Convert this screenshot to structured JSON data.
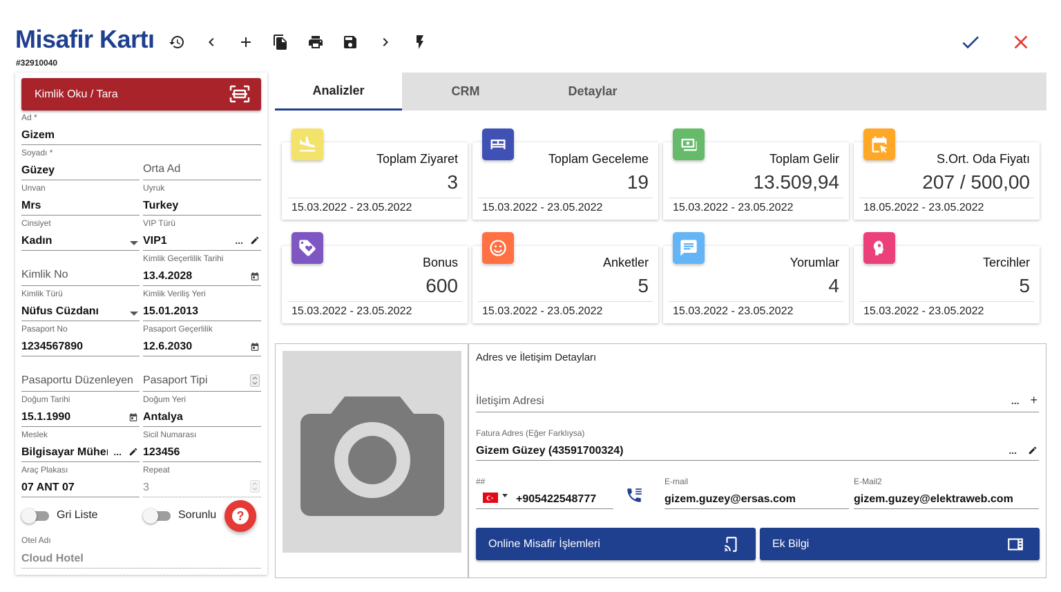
{
  "header": {
    "title": "Misafir Kartı",
    "record_id": "#32910040",
    "toolbar_icons": [
      "history-icon",
      "chevron-left-icon",
      "plus-icon",
      "copy-icon",
      "print-icon",
      "save-icon",
      "chevron-right-icon",
      "flash-icon"
    ],
    "confirm_icon": "check-icon",
    "close_icon": "close-icon",
    "accent": "#1f3f8f",
    "danger": "#e53935"
  },
  "left": {
    "scan_button": "Kimlik Oku / Tara",
    "ad": {
      "label": "Ad *",
      "value": "Gizem"
    },
    "soyadi": {
      "label": "Soyadı *",
      "value": "Güzey"
    },
    "orta_ad": {
      "placeholder": "Orta Ad"
    },
    "unvan": {
      "label": "Unvan",
      "value": "Mrs"
    },
    "uyruk": {
      "label": "Uyruk",
      "value": "Turkey"
    },
    "cinsiyet": {
      "label": "Cinsiyet",
      "value": "Kadın"
    },
    "vip_turu": {
      "label": "VIP Türü",
      "value": "VIP1"
    },
    "kimlik_no": {
      "placeholder": "Kimlik No"
    },
    "kimlik_gecerlilik": {
      "label": "Kimlik Geçerlilik Tarihi",
      "value": "13.4.2028"
    },
    "kimlik_turu": {
      "label": "Kimlik Türü",
      "value": "Nüfus Cüzdanı"
    },
    "kimlik_verilis": {
      "label": "Kimlik Veriliş Yeri",
      "value": "15.01.2013"
    },
    "pasaport_no": {
      "label": "Pasaport No",
      "value": "1234567890"
    },
    "pasaport_gecerlilik": {
      "label": "Pasaport Geçerlilik",
      "value": "12.6.2030"
    },
    "pasaport_duzenleyen": {
      "placeholder": "Pasaportu Düzenleyen"
    },
    "pasaport_tipi": {
      "placeholder": "Pasaport Tipi"
    },
    "dogum_tarihi": {
      "label": "Doğum Tarihi",
      "value": "15.1.1990"
    },
    "dogum_yeri": {
      "label": "Doğum Yeri",
      "value": "Antalya"
    },
    "meslek": {
      "label": "Meslek",
      "value": "Bilgisayar Müher"
    },
    "sicil": {
      "label": "Sicil Numarası",
      "value": "123456"
    },
    "arac_plakasi": {
      "label": "Araç Plakası",
      "value": "07 ANT 07"
    },
    "repeat": {
      "label": "Repeat",
      "value": "3"
    },
    "gri_liste": "Gri Liste",
    "sorunlu": "Sorunlu",
    "otel_adi": {
      "label": "Otel Adı",
      "value": "Cloud Hotel"
    },
    "ellipsis": "...",
    "help_glyph": "?"
  },
  "tabs": [
    "Analizler",
    "CRM",
    "Detaylar"
  ],
  "cards": [
    {
      "title": "Toplam Ziyaret",
      "value": "3",
      "date": "15.03.2022 - 23.05.2022",
      "icon": "flight-land-icon",
      "color": "#f4e36b"
    },
    {
      "title": "Toplam Geceleme",
      "value": "19",
      "date": "15.03.2022 - 23.05.2022",
      "icon": "bed-icon",
      "color": "#3f51b5"
    },
    {
      "title": "Toplam Gelir",
      "value": "13.509,94",
      "date": "15.03.2022 - 23.05.2022",
      "icon": "money-icon",
      "color": "#66bb6a"
    },
    {
      "title": "S.Ort. Oda Fiyatı",
      "value": "207 / 500,00",
      "date": "18.05.2022 - 23.05.2022",
      "icon": "calendar-icon",
      "color": "#ffa726"
    },
    {
      "title": "Bonus",
      "value": "600",
      "date": "15.03.2022 - 23.05.2022",
      "icon": "tag-icon",
      "color": "#7e57c2"
    },
    {
      "title": "Anketler",
      "value": "5",
      "date": "15.03.2022 - 23.05.2022",
      "icon": "smile-icon",
      "color": "#ff7043"
    },
    {
      "title": "Yorumlar",
      "value": "4",
      "date": "15.03.2022 - 23.05.2022",
      "icon": "comment-icon",
      "color": "#64b5f6"
    },
    {
      "title": "Tercihler",
      "value": "5",
      "date": "15.03.2022 - 23.05.2022",
      "icon": "preference-icon",
      "color": "#ec407a"
    }
  ],
  "address": {
    "title": "Adres ve İletişim Detayları",
    "iletisim_adresi": {
      "placeholder": "İletişim Adresi"
    },
    "fatura": {
      "label": "Fatura Adres (Eğer Farklıysa)",
      "value": "Gizem Güzey (43591700324)"
    },
    "phone": {
      "label": "##",
      "value": "+905422548777"
    },
    "email": {
      "label": "E-mail",
      "value": "gizem.guzey@ersas.com"
    },
    "email2": {
      "label": "E-Mail2",
      "value": "gizem.guzey@elektraweb.com"
    },
    "online_button": "Online Misafir İşlemleri",
    "ek_bilgi_button": "Ek Bilgi",
    "plus": "+"
  }
}
